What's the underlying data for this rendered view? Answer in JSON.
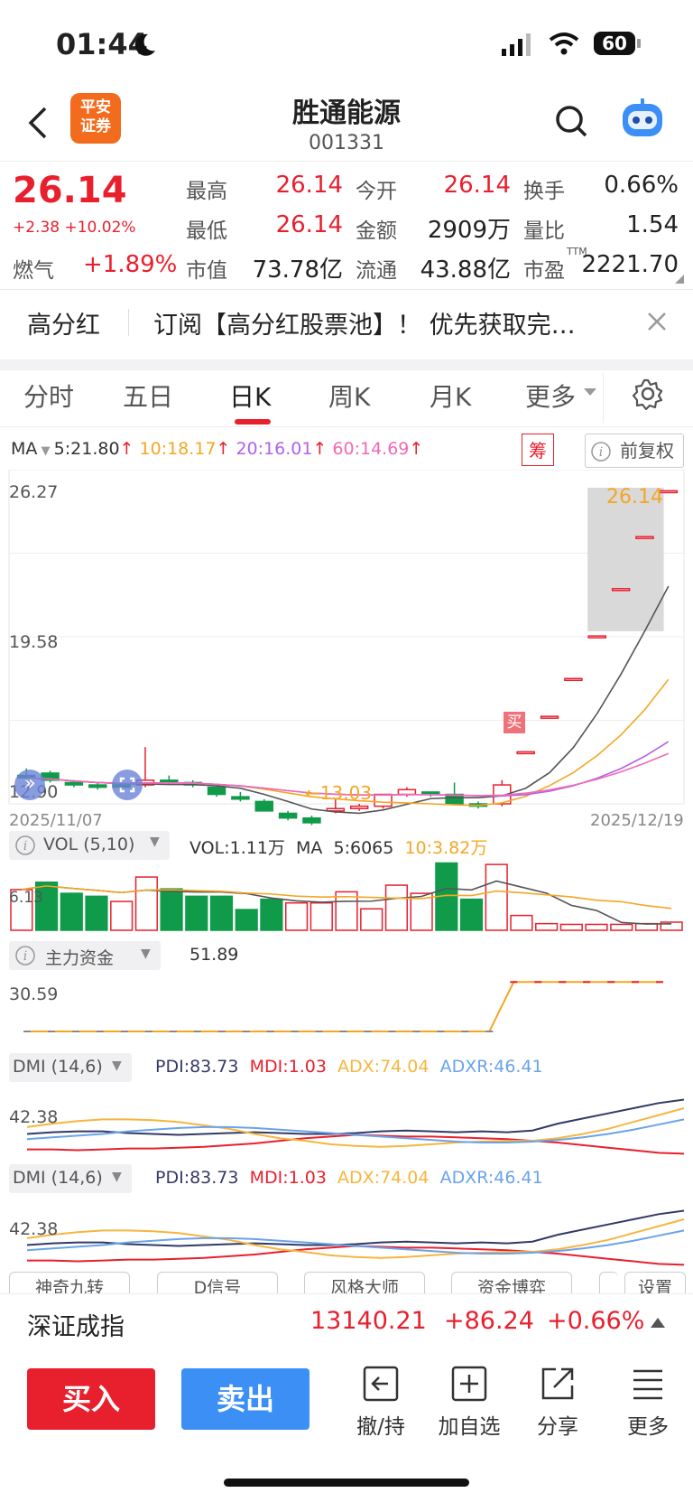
{
  "status": {
    "time": "01:44",
    "battery": "60"
  },
  "header": {
    "name": "胜通能源",
    "code": "001331",
    "broker_logo": "平安\n证券"
  },
  "quote": {
    "price": "26.14",
    "change": "+2.38 +10.02%",
    "sector_name": "燃气",
    "sector_change": "+1.89%",
    "rows": [
      [
        {
          "label": "最高",
          "value": "26.14",
          "color": "red"
        },
        {
          "label": "今开",
          "value": "26.14",
          "color": "red"
        },
        {
          "label": "换手",
          "value": "0.66%",
          "color": "black"
        }
      ],
      [
        {
          "label": "最低",
          "value": "26.14",
          "color": "red"
        },
        {
          "label": "金额",
          "value": "2909万",
          "color": "black"
        },
        {
          "label": "量比",
          "value": "1.54",
          "color": "black"
        }
      ],
      [
        {
          "label": "市值",
          "value": "73.78亿",
          "color": "black"
        },
        {
          "label": "流通",
          "value": "43.88亿",
          "color": "black"
        },
        {
          "label": "市盈",
          "value": "2221.70",
          "color": "black"
        }
      ]
    ],
    "ttm": "TTM"
  },
  "banner": {
    "tag": "高分红",
    "text": "订阅【高分红股票池】！ 优先获取完…"
  },
  "tabs": [
    "分时",
    "五日",
    "日K",
    "周K",
    "月K",
    "更多"
  ],
  "active_tab": 2,
  "ma": {
    "label": "MA",
    "items": [
      {
        "text": "5:21.80",
        "color": "#333333"
      },
      {
        "text": "10:18.17",
        "color": "#f5a623"
      },
      {
        "text": "20:16.01",
        "color": "#b162e6"
      },
      {
        "text": "60:14.69",
        "color": "#f06ab5"
      }
    ],
    "chip_badge": "筹",
    "fuquan": "前复权"
  },
  "kline": {
    "y_top": "26.27",
    "y_mid": "19.58",
    "y_bottom": "12.90",
    "date_start": "2025/11/07",
    "date_end": "2025/12/19",
    "high_label": "26.14",
    "low_label": "13.03",
    "buy_badge": "买"
  },
  "vol": {
    "title": "VOL (5,10)",
    "value": "VOL:1.11万",
    "ma_label": "MA",
    "ma5": "5:6065",
    "ma10": "10:3.82万",
    "y_label": "6.13"
  },
  "fund": {
    "title": "主力资金",
    "value": "51.89",
    "y_label": "30.59"
  },
  "dmi": {
    "title": "DMI (14,6)",
    "pdi": "PDI:83.73",
    "mdi": "MDI:1.03",
    "adx": "ADX:74.04",
    "adxr": "ADXR:46.41",
    "y_label": "42.38"
  },
  "bottom_tabs": [
    "神奇九转",
    "D信号",
    "风格大师",
    "资金博弈",
    "设置"
  ],
  "index": {
    "name": "深证成指",
    "value": "13140.21",
    "change": "+86.24",
    "pct": "+0.66%"
  },
  "actions": {
    "buy": "买入",
    "sell": "卖出",
    "items": [
      "撤/持",
      "加自选",
      "分享",
      "更多"
    ]
  },
  "colors": {
    "up": "#e8202e",
    "down": "#109b4b",
    "accent": "#e8202e",
    "sell_blue": "#3c8ff5"
  },
  "chart_data": [
    {
      "type": "candlestick",
      "title": "",
      "x_range": [
        "2025/11/07",
        "2025/12/19"
      ],
      "ylim": [
        12.9,
        26.27
      ],
      "candles": [
        {
          "o": 14.1,
          "c": 14.0,
          "h": 14.4,
          "l": 13.8
        },
        {
          "o": 14.2,
          "c": 13.9,
          "h": 14.3,
          "l": 13.8
        },
        {
          "o": 13.8,
          "c": 13.7,
          "h": 13.9,
          "l": 13.6
        },
        {
          "o": 13.7,
          "c": 13.6,
          "h": 13.8,
          "l": 13.5
        },
        {
          "o": 13.7,
          "c": 13.6,
          "h": 13.8,
          "l": 13.5
        },
        {
          "o": 13.7,
          "c": 13.9,
          "h": 15.3,
          "l": 13.6
        },
        {
          "o": 13.9,
          "c": 13.8,
          "h": 14.1,
          "l": 13.7
        },
        {
          "o": 13.8,
          "c": 13.7,
          "h": 13.9,
          "l": 13.6
        },
        {
          "o": 13.6,
          "c": 13.3,
          "h": 13.7,
          "l": 13.2
        },
        {
          "o": 13.2,
          "c": 13.1,
          "h": 13.4,
          "l": 13.0
        },
        {
          "o": 13.0,
          "c": 12.6,
          "h": 13.1,
          "l": 12.6
        },
        {
          "o": 12.5,
          "c": 12.3,
          "h": 12.6,
          "l": 12.2
        },
        {
          "o": 12.3,
          "c": 12.1,
          "h": 12.4,
          "l": 12.0
        },
        {
          "o": 12.6,
          "c": 12.7,
          "h": 13.1,
          "l": 12.5
        },
        {
          "o": 12.7,
          "c": 12.8,
          "h": 12.9,
          "l": 12.6
        },
        {
          "o": 12.8,
          "c": 13.3,
          "h": 13.3,
          "l": 12.7
        },
        {
          "o": 13.3,
          "c": 13.5,
          "h": 13.6,
          "l": 13.2
        },
        {
          "o": 13.4,
          "c": 13.3,
          "h": 13.4,
          "l": 13.2
        },
        {
          "o": 13.3,
          "c": 12.9,
          "h": 13.8,
          "l": 12.9
        },
        {
          "o": 12.9,
          "c": 12.8,
          "h": 13.0,
          "l": 12.7
        },
        {
          "o": 12.9,
          "c": 13.7,
          "h": 13.9,
          "l": 12.8
        },
        {
          "o": 15.1,
          "c": 15.1,
          "h": 15.1,
          "l": 15.1
        },
        {
          "o": 16.6,
          "c": 16.6,
          "h": 16.6,
          "l": 16.6
        },
        {
          "o": 18.2,
          "c": 18.2,
          "h": 18.2,
          "l": 18.2
        },
        {
          "o": 20.0,
          "c": 20.0,
          "h": 20.0,
          "l": 20.0
        },
        {
          "o": 22.0,
          "c": 22.0,
          "h": 22.0,
          "l": 22.0
        },
        {
          "o": 24.2,
          "c": 24.2,
          "h": 24.2,
          "l": 24.2
        },
        {
          "o": 26.14,
          "c": 26.14,
          "h": 26.14,
          "l": 26.14
        }
      ]
    },
    {
      "type": "bar",
      "title": "VOL (5,10)",
      "values": [
        5.5,
        6.5,
        5.0,
        4.6,
        3.9,
        7.2,
        5.6,
        4.6,
        4.6,
        2.8,
        4.2,
        3.7,
        3.7,
        5.2,
        2.9,
        6.1,
        5.0,
        9.1,
        4.2,
        8.9,
        2.0,
        0.9,
        0.8,
        0.8,
        0.8,
        0.9,
        1.1
      ]
    },
    {
      "type": "line",
      "title": "主力资金",
      "values": [
        0,
        0,
        0,
        0,
        0,
        0,
        0,
        0,
        0,
        0,
        0,
        0,
        0,
        0,
        0,
        0,
        0,
        0,
        0,
        0,
        51.89,
        51.89,
        51.89,
        51.89,
        51.89,
        51.89,
        51.89
      ]
    }
  ]
}
